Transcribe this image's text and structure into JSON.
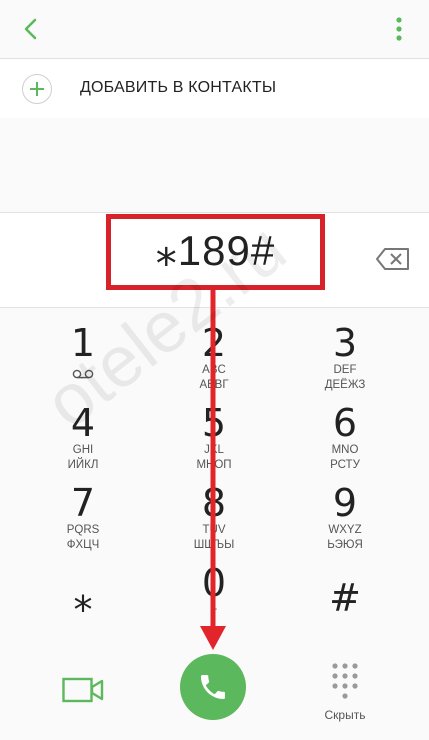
{
  "header": {
    "back_icon": "chevron-left-icon",
    "menu_icon": "vertical-dots-icon",
    "accent": "#5cb85c"
  },
  "add_contact": {
    "icon": "plus-icon",
    "label": "ДОБАВИТЬ В КОНТАКТЫ"
  },
  "dialer": {
    "number": "⁎189#",
    "backspace_icon": "backspace-icon",
    "highlight_color": "#d7222a"
  },
  "keypad": {
    "keys": [
      {
        "digit": "1",
        "sub": "",
        "extra": "voicemail-icon"
      },
      {
        "digit": "2",
        "sub": "ABC\nАБВГ"
      },
      {
        "digit": "3",
        "sub": "DEF\nДЕЁЖЗ"
      },
      {
        "digit": "4",
        "sub": "GHI\nИЙКЛ"
      },
      {
        "digit": "5",
        "sub": "JKL\nМНОП"
      },
      {
        "digit": "6",
        "sub": "MNO\nРСТУ"
      },
      {
        "digit": "7",
        "sub": "PQRS\nФХЦЧ"
      },
      {
        "digit": "8",
        "sub": "TUV\nШЩЪЫ"
      },
      {
        "digit": "9",
        "sub": "WXYZ\nЬЭЮЯ"
      },
      {
        "digit": "⁎",
        "sub": ""
      },
      {
        "digit": "0",
        "sub": "+"
      },
      {
        "digit": "#",
        "sub": ""
      }
    ],
    "key_lines": {
      "k2a": "ABC",
      "k2b": "АБВГ",
      "k3a": "DEF",
      "k3b": "ДЕЁЖЗ",
      "k4a": "GHI",
      "k4b": "ИЙКЛ",
      "k5a": "JKL",
      "k5b": "МНОП",
      "k6a": "MNO",
      "k6b": "РСТУ",
      "k7a": "PQRS",
      "k7b": "ФХЦЧ",
      "k8a": "TUV",
      "k8b": "ШЩЪЫ",
      "k9a": "WXYZ",
      "k9b": "ЬЭЮЯ",
      "k0a": "+"
    }
  },
  "bottom": {
    "video_icon": "video-call-icon",
    "call_icon": "phone-icon",
    "call_color": "#5cb85c",
    "hide_icon": "keypad-grid-icon",
    "hide_label": "Скрыть"
  },
  "watermark": "otele2.ru"
}
